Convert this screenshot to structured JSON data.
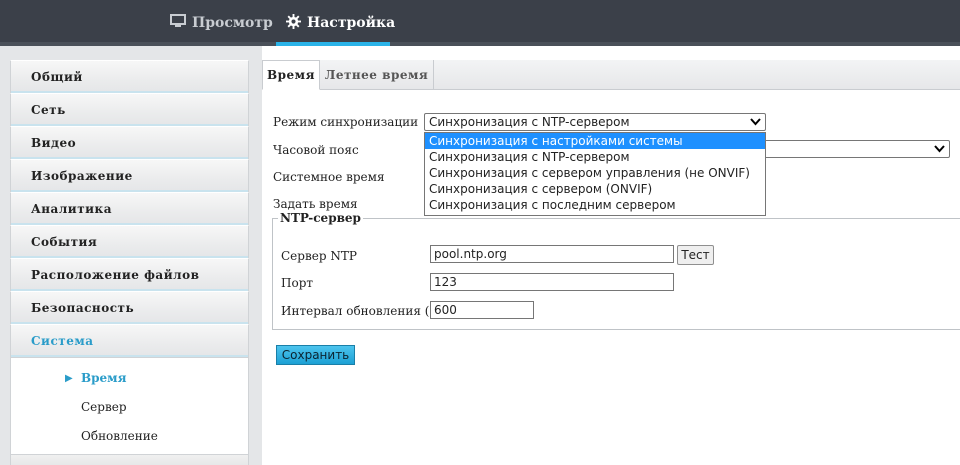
{
  "topnav": {
    "view_label": "Просмотр",
    "settings_label": "Настройка",
    "accent_color": "#2ab3e8",
    "view_icon": "monitor-icon",
    "settings_icon": "gear-icon"
  },
  "sidebar": {
    "items": [
      {
        "label": "Общий"
      },
      {
        "label": "Сеть"
      },
      {
        "label": "Видео"
      },
      {
        "label": "Изображение"
      },
      {
        "label": "Аналитика"
      },
      {
        "label": "События"
      },
      {
        "label": "Расположение файлов"
      },
      {
        "label": "Безопасность"
      },
      {
        "label": "Система",
        "active": true
      }
    ],
    "subitems": [
      {
        "label": "Время",
        "active": true
      },
      {
        "label": "Сервер"
      },
      {
        "label": "Обновление"
      }
    ]
  },
  "tabs": [
    {
      "label": "Время",
      "active": true
    },
    {
      "label": "Летнее время"
    }
  ],
  "form": {
    "sync_mode_label": "Режим синхронизации",
    "sync_mode_value": "Синхронизация с NTP-сервером",
    "timezone_label": "Часовой пояс",
    "system_time_label": "Системное время",
    "set_time_label": "Задать время",
    "dropdown_options": [
      "Синхронизация с настройками системы",
      "Синхронизация с NTP-сервером",
      "Синхронизация с сервером управления (не ONVIF)",
      "Синхронизация с сервером (ONVIF)",
      "Синхронизация с последним сервером"
    ],
    "dropdown_highlighted": "Синхронизация с настройками системы"
  },
  "ntp": {
    "legend": "NTP-сервер",
    "server_label": "Сервер NTP",
    "server_value": "pool.ntp.org",
    "test_button": "Тест",
    "port_label": "Порт",
    "port_value": "123",
    "interval_label": "Интервал обновления (с)",
    "interval_value": "600"
  },
  "save_button": "Сохранить"
}
